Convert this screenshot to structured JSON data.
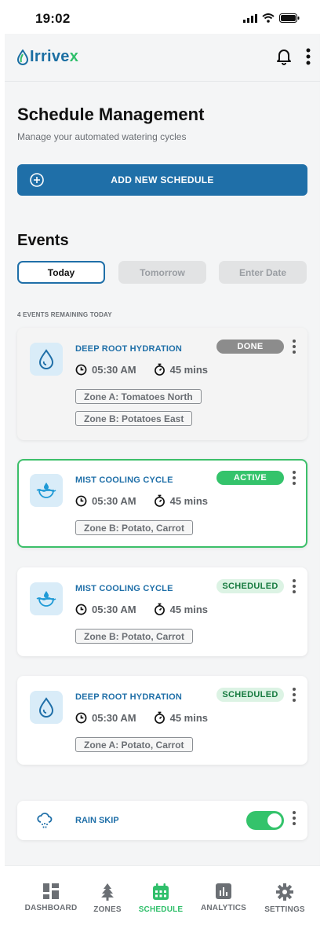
{
  "status_bar": {
    "time": "19:02"
  },
  "header": {
    "brand": "Irrive",
    "brand_accent": "x"
  },
  "page": {
    "title": "Schedule Management",
    "subtitle": "Manage your automated watering cycles",
    "add_button": "ADD NEW SCHEDULE"
  },
  "events": {
    "heading": "Events",
    "tabs": [
      "Today",
      "Tomorrow",
      "Enter Date"
    ],
    "active_tab": "Today",
    "remaining": "4 EVENTS REMAINING TODAY",
    "items": [
      {
        "title": "DEEP ROOT HYDRATION",
        "time": "05:30 AM",
        "duration": "45 mins",
        "status": "DONE",
        "icon": "droplet-icon",
        "zones": [
          "Zone A: Tomatoes North",
          "Zone B: Potatoes East"
        ]
      },
      {
        "title": "MIST COOLING CYCLE",
        "time": "05:30 AM",
        "duration": "45 mins",
        "status": "ACTIVE",
        "icon": "mist-icon",
        "zones": [
          "Zone B: Potato, Carrot"
        ]
      },
      {
        "title": "MIST COOLING CYCLE",
        "time": "05:30 AM",
        "duration": "45 mins",
        "status": "SCHEDULED",
        "icon": "mist-icon",
        "zones": [
          "Zone B: Potato, Carrot"
        ]
      },
      {
        "title": "DEEP ROOT HYDRATION",
        "time": "05:30 AM",
        "duration": "45 mins",
        "status": "SCHEDULED",
        "icon": "droplet-icon",
        "zones": [
          "Zone A: Potato, Carrot"
        ]
      }
    ]
  },
  "rain_skip": {
    "label": "RAIN SKIP",
    "enabled": true
  },
  "nav": {
    "items": [
      "DASHBOARD",
      "ZONES",
      "SCHEDULE",
      "ANALYTICS",
      "SETTINGS"
    ],
    "selected": "SCHEDULE"
  },
  "colors": {
    "primary": "#1f6fa8",
    "accent_green": "#34c36b",
    "badge_done": "#8c8c8c",
    "badge_scheduled_bg": "#dcf3e4"
  }
}
